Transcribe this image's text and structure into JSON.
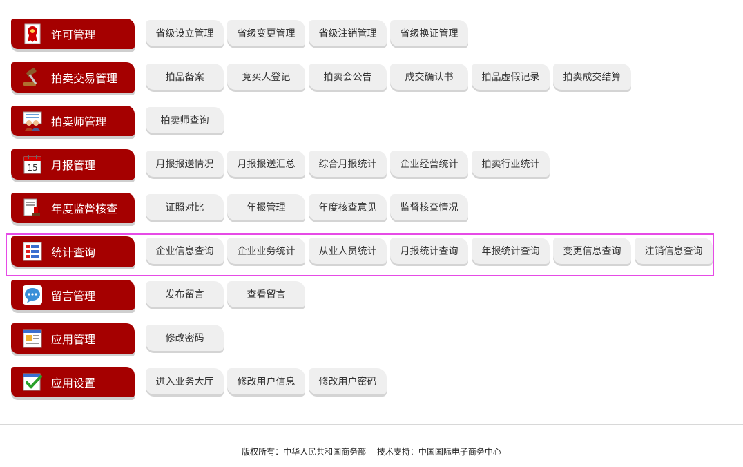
{
  "sections": [
    {
      "label": "许可管理",
      "icon": "license-badge-icon",
      "items": [
        "省级设立管理",
        "省级变更管理",
        "省级注销管理",
        "省级换证管理"
      ]
    },
    {
      "label": "拍卖交易管理",
      "icon": "auction-gavel-icon",
      "items": [
        "拍品备案",
        "竞买人登记",
        "拍卖会公告",
        "成交确认书",
        "拍品虚假记录",
        "拍卖成交结算"
      ]
    },
    {
      "label": "拍卖师管理",
      "icon": "auctioneer-people-icon",
      "items": [
        "拍卖师查询"
      ]
    },
    {
      "label": "月报管理",
      "icon": "calendar-icon",
      "calendar_day": "15",
      "items": [
        "月报报送情况",
        "月报报送汇总",
        "综合月报统计",
        "企业经营统计",
        "拍卖行业统计"
      ]
    },
    {
      "label": "年度监督核查",
      "icon": "inspection-stamp-icon",
      "items": [
        "证照对比",
        "年报管理",
        "年度核查意见",
        "监督核查情况"
      ]
    },
    {
      "label": "统计查询",
      "icon": "statistics-list-icon",
      "items": [
        "企业信息查询",
        "企业业务统计",
        "从业人员统计",
        "月报统计查询",
        "年报统计查询",
        "变更信息查询",
        "注销信息查询"
      ]
    },
    {
      "label": "留言管理",
      "icon": "message-bubble-icon",
      "items": [
        "发布留言",
        "查看留言"
      ]
    },
    {
      "label": "应用管理",
      "icon": "app-window-icon",
      "items": [
        "修改密码"
      ]
    },
    {
      "label": "应用设置",
      "icon": "settings-check-icon",
      "items": [
        "进入业务大厅",
        "修改用户信息",
        "修改用户密码"
      ]
    }
  ],
  "footer": {
    "copyright": "版权所有：中华人民共和国商务部",
    "support": "技术支持：中国国际电子商务中心"
  },
  "colors": {
    "category_bg": "#a50000",
    "button_bg": "#efefef",
    "highlight_border": "#e64be6"
  }
}
